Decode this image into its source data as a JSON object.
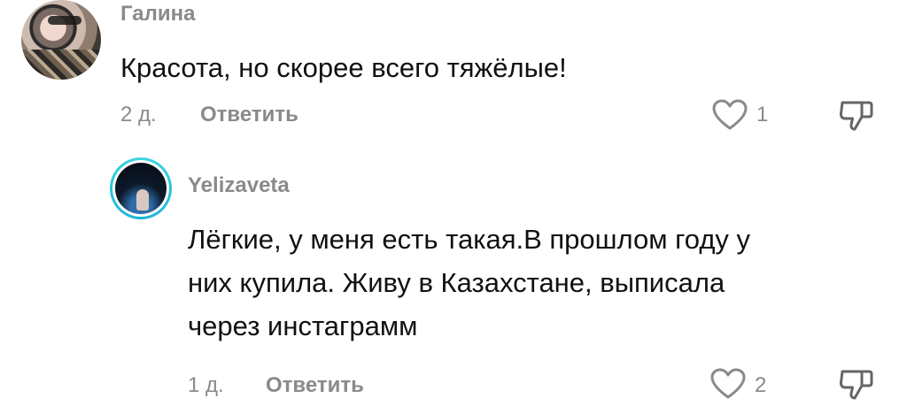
{
  "comments": [
    {
      "author": "Галина",
      "text": "Красота, но скорее всего тяжёлые!",
      "time": "2 д.",
      "reply_label": "Ответить",
      "likes": "1"
    },
    {
      "author": "Yelizaveta",
      "text_lines": [
        "Лёгкие, у меня есть такая.В прошлом году у",
        "них купила. Живу в Казахстане, выписала",
        "через инстаграмм"
      ],
      "time": "1 д.",
      "reply_label": "Ответить",
      "likes": "2"
    }
  ],
  "colors": {
    "meta_gray": "#8a8a8a",
    "text": "#111111",
    "story_ring": "#3fd7e0"
  },
  "icons": {
    "like": "heart-outline-icon",
    "dislike": "thumbs-down-icon"
  }
}
